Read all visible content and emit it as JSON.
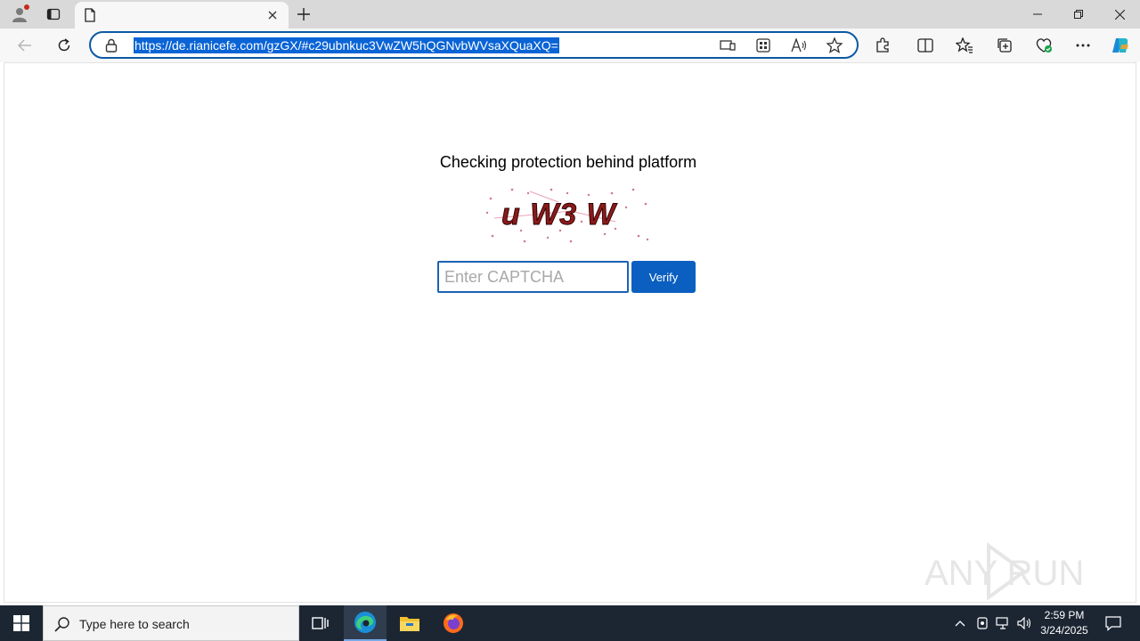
{
  "browser": {
    "tab": {
      "title": ""
    },
    "address_bar": {
      "url": "https://de.rianicefe.com/gzGX/#c29ubnkuc3VwZW5hQGNvbWVsaXQuaXQ="
    },
    "icons": [
      "profile-icon",
      "tab-actions-icon",
      "page-icon",
      "close-icon",
      "new-tab-icon",
      "minimize-icon",
      "restore-icon",
      "window-close-icon",
      "back-icon",
      "refresh-icon",
      "lock-icon",
      "device-icon",
      "apps-icon",
      "read-aloud-icon",
      "favorite-star-icon",
      "extensions-icon",
      "split-screen-icon",
      "favorites-icon",
      "collections-icon",
      "browser-essentials-icon",
      "more-icon",
      "copilot-icon"
    ]
  },
  "page": {
    "heading": "Checking protection behind platform",
    "captcha_text": "u W3 W",
    "input": {
      "placeholder": "Enter CAPTCHA",
      "value": ""
    },
    "verify_label": "Verify",
    "watermark": "ANY RUN"
  },
  "taskbar": {
    "search_placeholder": "Type here to search",
    "clock": {
      "time": "2:59 PM",
      "date": "3/24/2025"
    }
  },
  "colors": {
    "accent": "#0a5fc0",
    "taskbar": "#1c2633",
    "captcha_text": "#8b1a1a"
  }
}
